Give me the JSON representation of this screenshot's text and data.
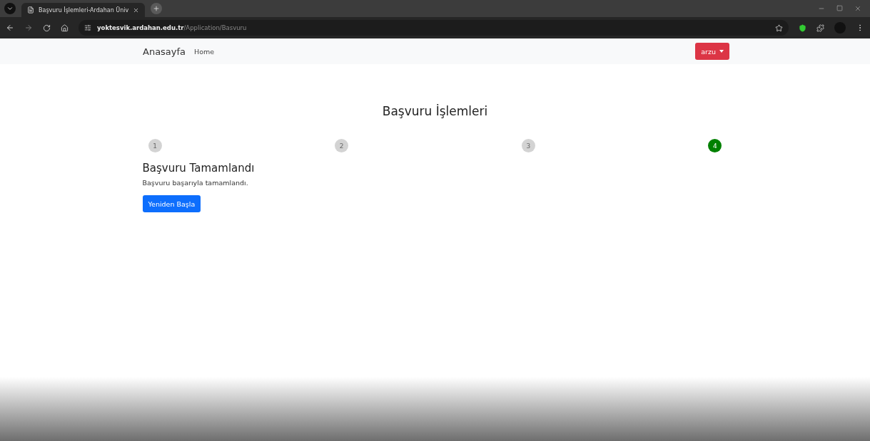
{
  "browser": {
    "tab_title": "Başvuru İşlemleri-Ardahan Üniv",
    "url_host": "yoktesvik.ardahan.edu.tr",
    "url_path": "/Application/Basvuru"
  },
  "navbar": {
    "brand": "Anasayfa",
    "links": [
      "Home"
    ],
    "user_button": "arzu"
  },
  "page_title": "Başvuru İşlemleri",
  "steps": [
    {
      "label": "1",
      "selected": false
    },
    {
      "label": "2",
      "selected": false
    },
    {
      "label": "3",
      "selected": false
    },
    {
      "label": "4",
      "selected": true
    }
  ],
  "result": {
    "heading": "Başvuru Tamamlandı",
    "message": "Başvuru başarıyla tamamlandı.",
    "button": "Yeniden Başla"
  }
}
